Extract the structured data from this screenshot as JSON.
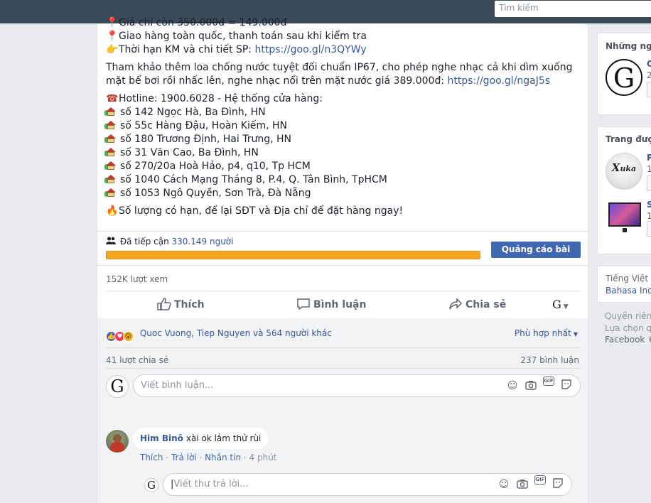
{
  "topbar": {
    "search_placeholder": "Tìm kiếm"
  },
  "post": {
    "line_price_prefix": "Giá chỉ còn ",
    "line_price_old": "350.000đ",
    "line_price_new": " = 149.000đ",
    "line_delivery": "Giao hàng toàn quốc, thanh toán sau khi kiểm tra",
    "line_promo_prefix": "Thời hạn KM và chi tiết SP: ",
    "line_promo_link": "https://goo.gl/n3QYWy",
    "para_speaker_text": "Tham khảo thêm loa chống nước tuyệt đối chuẩn IP67, cho phép nghe nhạc cả khi dìm xuống mặt bể bơi rồi nhấc lên, nghe nhạc nổi trên mặt nước giá 389.000đ: ",
    "para_speaker_link": "https://goo.gl/ngaJ5s",
    "hotline": "Hotline: 1900.6028 - Hệ thống cửa hàng:",
    "stores": [
      "số 142 Ngọc Hà, Ba Đình, HN",
      "số 55c Hàng Đậu, Hoàn Kiếm, HN",
      "số 180 Trương Định, Hai Trưng, HN",
      "số 31 Văn Cao, Ba Đình, HN",
      "số 270/20a Hoà Hảo, p4, q10, Tp HCM",
      "số 1040 Cách Mạng Tháng 8, P.4, Q. Tân Bình, TpHCM",
      "số 1053 Ngô Quyền, Sơn Trà, Đà Nẵng"
    ],
    "limited": "Số lượng có hạn, để lại SĐT và Địa chỉ để đặt hàng ngay!",
    "reach_label": "Đã tiếp cận ",
    "reach_count": "330.149 người",
    "promote_button": "Quảng cáo bài viết",
    "views": "152K lượt xem",
    "actions": {
      "like": "Thích",
      "comment": "Bình luận",
      "share": "Chia sẻ"
    },
    "reactions_text": "Quoc Vuong, Tiep Nguyen và 564 người khác",
    "sort_label": "Phù hợp nhất",
    "shares_count": "41 lượt chia sẻ",
    "comments_count": "237 bình luận",
    "comment_input_placeholder": "Viết bình luận...",
    "comment": {
      "author": "Him Binô",
      "text": "xài ok lắm thử rùi",
      "like": "Thích",
      "reply": "Trả lời",
      "message": "Nhắn tin",
      "time": "4 phút"
    },
    "reply_input_placeholder": "Viết thư trả lời...",
    "more": "...",
    "progress_fraction": 1.0
  },
  "sidebar": {
    "people_title": "Những người",
    "people_sub": "2",
    "people_name_initial": "C",
    "pages_title": "Trang được",
    "page1_initial": "P",
    "page1_sub": "1",
    "page2_initial": "S",
    "page2_sub": "1",
    "lang_current": "Tiếng Việt ·",
    "lang_alt": "Bahasa Indo",
    "footer1": "Quyền riêng",
    "footer2": "Lựa chọn q",
    "footer3": "Facebook ©"
  },
  "colors": {
    "topbar": "#3b4a59",
    "link": "#365899",
    "promote": "#4267b2",
    "progress": "#f39c12"
  }
}
